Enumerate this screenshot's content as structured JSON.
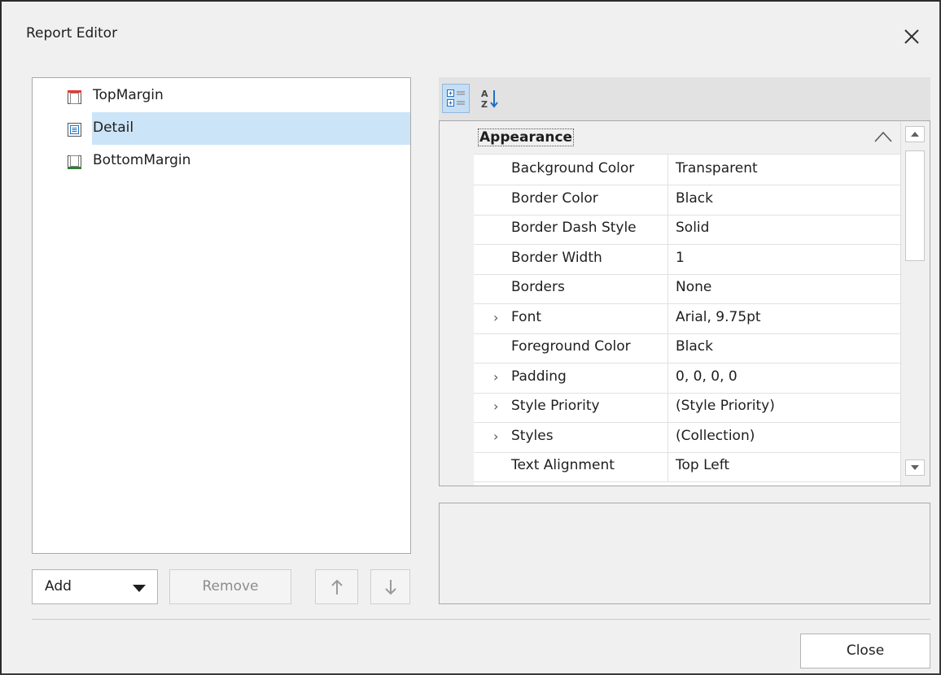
{
  "window": {
    "title": "Report Editor"
  },
  "bands": [
    {
      "label": "TopMargin",
      "icon": "top-margin-band-icon"
    },
    {
      "label": "Detail",
      "icon": "detail-band-icon",
      "selected": true
    },
    {
      "label": "BottomMargin",
      "icon": "bottom-margin-band-icon"
    }
  ],
  "buttons": {
    "add": "Add",
    "remove": "Remove",
    "close": "Close"
  },
  "property_grid": {
    "category": "Appearance",
    "rows": [
      {
        "name": "Background Color",
        "value": "Transparent",
        "expandable": false
      },
      {
        "name": "Border Color",
        "value": "Black",
        "expandable": false
      },
      {
        "name": "Border Dash Style",
        "value": "Solid",
        "expandable": false
      },
      {
        "name": "Border Width",
        "value": "1",
        "expandable": false
      },
      {
        "name": "Borders",
        "value": "None",
        "expandable": false
      },
      {
        "name": "Font",
        "value": "Arial, 9.75pt",
        "expandable": true
      },
      {
        "name": "Foreground Color",
        "value": "Black",
        "expandable": false
      },
      {
        "name": "Padding",
        "value": "0, 0, 0, 0",
        "expandable": true
      },
      {
        "name": "Style Priority",
        "value": "(Style Priority)",
        "expandable": true
      },
      {
        "name": "Styles",
        "value": "(Collection)",
        "expandable": true
      },
      {
        "name": "Text Alignment",
        "value": "Top Left",
        "expandable": false
      }
    ]
  },
  "colors": {
    "selection": "#cce4f7",
    "top_margin_accent": "#e53935",
    "bottom_margin_accent": "#2e7d32",
    "detail_accent": "#1f6fc5"
  }
}
